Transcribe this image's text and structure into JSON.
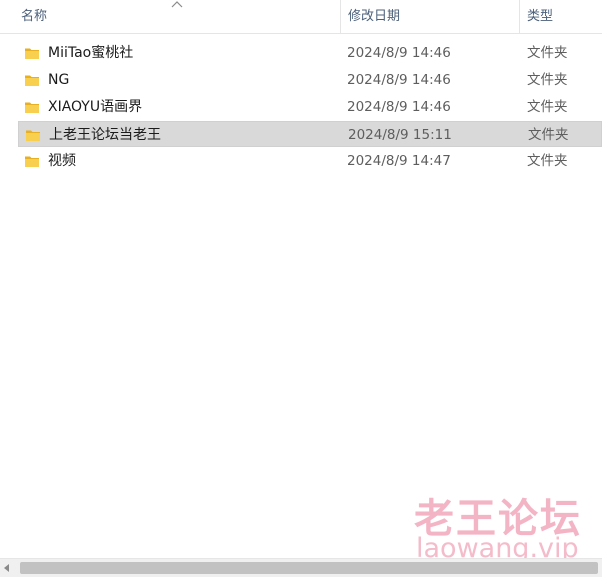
{
  "columns": {
    "name": "名称",
    "date": "修改日期",
    "type": "类型"
  },
  "icons": {
    "folder": "folder-icon",
    "sort": "sort-ascending-icon"
  },
  "colors": {
    "folder": "#f5c542",
    "selection": "#d9d9d9",
    "watermark": "#e97896"
  },
  "rows": [
    {
      "name": "MiiTao蜜桃社",
      "date": "2024/8/9 14:46",
      "type": "文件夹",
      "selected": false
    },
    {
      "name": "NG",
      "date": "2024/8/9 14:46",
      "type": "文件夹",
      "selected": false
    },
    {
      "name": "XIAOYU语画界",
      "date": "2024/8/9 14:46",
      "type": "文件夹",
      "selected": false
    },
    {
      "name": "上老王论坛当老王",
      "date": "2024/8/9 15:11",
      "type": "文件夹",
      "selected": true
    },
    {
      "name": "视频",
      "date": "2024/8/9 14:47",
      "type": "文件夹",
      "selected": false
    }
  ],
  "watermark": {
    "text_cn": "老王论坛",
    "text_en": "laowang.vip"
  }
}
